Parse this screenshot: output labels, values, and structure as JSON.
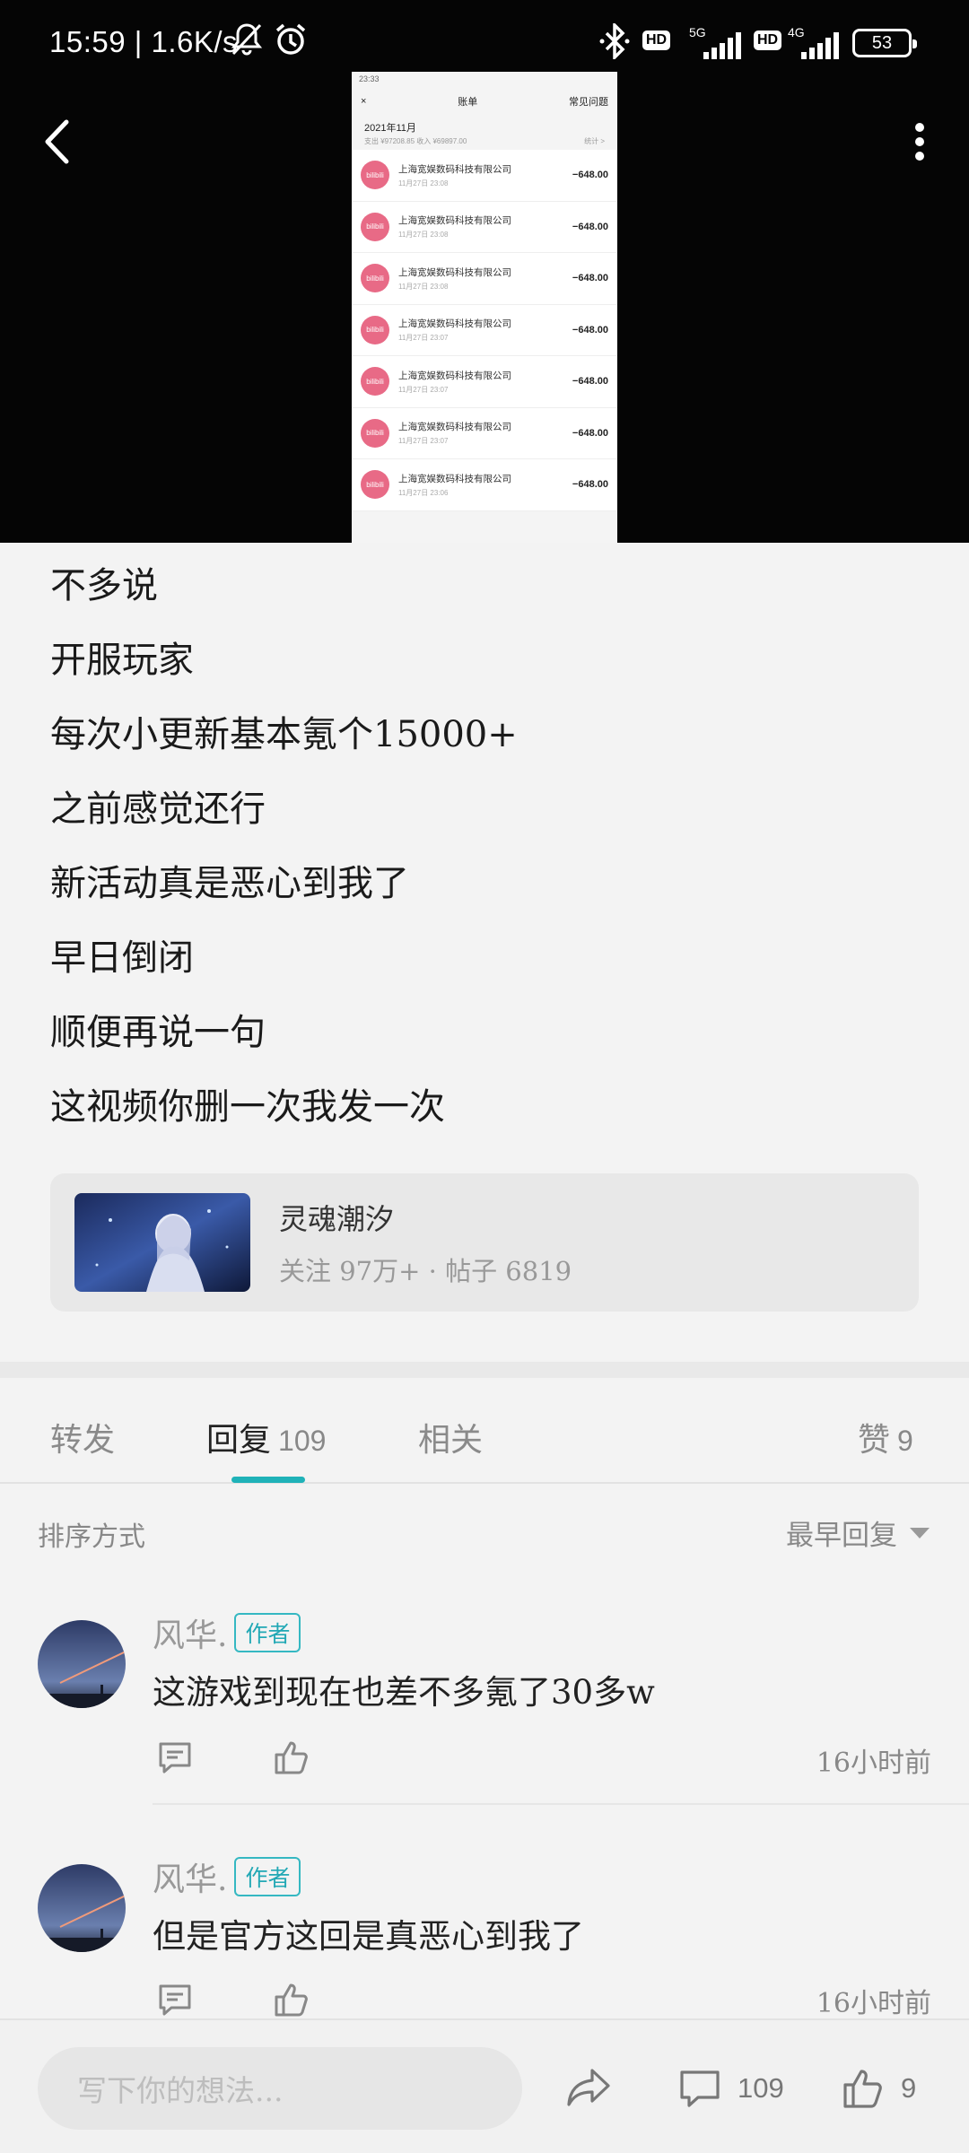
{
  "status_bar": {
    "time": "15:59 | 1.6K/s",
    "net_5g": "5G",
    "net_4g": "4G",
    "hd": "HD",
    "battery": "53",
    "icons": [
      "mute-bell-icon",
      "alarm-icon",
      "bluetooth-icon",
      "signal-icon",
      "battery-icon"
    ]
  },
  "nav": {
    "back_icon": "back-arrow-icon",
    "more_icon": "more-vertical-icon"
  },
  "video_screenshot": {
    "status_time": "23:33",
    "header_title": "账单",
    "header_right": "常见问题",
    "close": "×",
    "month": "2021年11月",
    "summary": "支出 ¥97208.85 收入 ¥69897.00",
    "stats": "统计 >",
    "rows": [
      {
        "avatar": "bilibili",
        "name": "上海宽娱数码科技有限公司",
        "date": "11月27日 23:08",
        "amount": "−648.00"
      },
      {
        "avatar": "bilibili",
        "name": "上海宽娱数码科技有限公司",
        "date": "11月27日 23:08",
        "amount": "−648.00"
      },
      {
        "avatar": "bilibili",
        "name": "上海宽娱数码科技有限公司",
        "date": "11月27日 23:08",
        "amount": "−648.00"
      },
      {
        "avatar": "bilibili",
        "name": "上海宽娱数码科技有限公司",
        "date": "11月27日 23:07",
        "amount": "−648.00"
      },
      {
        "avatar": "bilibili",
        "name": "上海宽娱数码科技有限公司",
        "date": "11月27日 23:07",
        "amount": "−648.00"
      },
      {
        "avatar": "bilibili",
        "name": "上海宽娱数码科技有限公司",
        "date": "11月27日 23:07",
        "amount": "−648.00"
      },
      {
        "avatar": "bilibili",
        "name": "上海宽娱数码科技有限公司",
        "date": "11月27日 23:06",
        "amount": "−648.00"
      }
    ]
  },
  "post": {
    "lines": [
      "不多说",
      "开服玩家",
      "每次小更新基本氪个15000+",
      "之前感觉还行",
      "新活动真是恶心到我了",
      "早日倒闭",
      "顺便再说一句",
      "这视频你删一次我发一次"
    ]
  },
  "forum": {
    "name": "灵魂潮汐",
    "meta": "关注 97万+ · 帖子 6819"
  },
  "tabs": {
    "forward": "转发",
    "reply": "回复",
    "reply_count": "109",
    "related": "相关",
    "like": "赞",
    "like_count": "9"
  },
  "sort": {
    "label": "排序方式",
    "value": "最早回复"
  },
  "comments": [
    {
      "author": "风华.",
      "badge": "作者",
      "text": "这游戏到现在也差不多氪了30多w",
      "time": "16小时前"
    },
    {
      "author": "风华.",
      "badge": "作者",
      "text": "但是官方这回是真恶心到我了",
      "time": "16小时前"
    }
  ],
  "bottom_bar": {
    "placeholder": "写下你的想法...",
    "comment_count": "109",
    "like_count": "9"
  },
  "colors": {
    "accent": "#1fb2b8",
    "background": "#f3f3f3",
    "media_bg": "#050505"
  }
}
